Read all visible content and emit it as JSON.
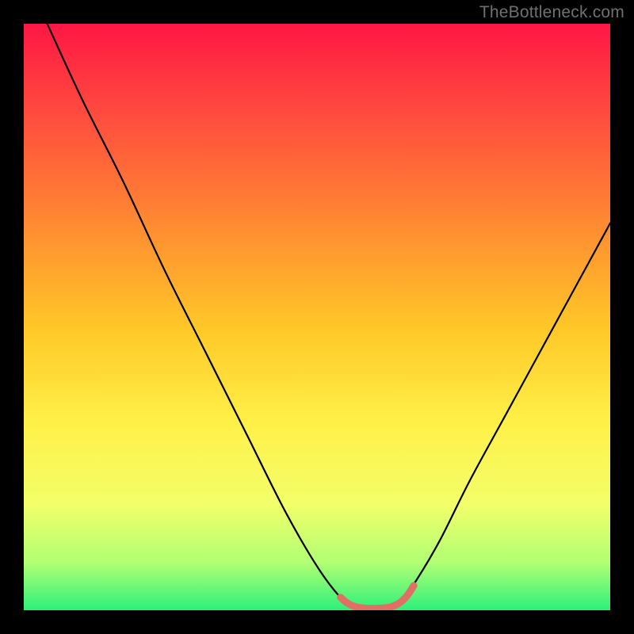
{
  "watermark": "TheBottleneck.com",
  "chart_data": {
    "type": "line",
    "title": "",
    "xlabel": "",
    "ylabel": "",
    "xlim": [
      0,
      100
    ],
    "ylim": [
      0,
      100
    ],
    "grid": false,
    "legend": false,
    "background_gradient": [
      "#ff1744",
      "#ff5a3c",
      "#ffa030",
      "#ffd82a",
      "#fff44a",
      "#f6ff70",
      "#a8ff7a",
      "#38f47a"
    ],
    "series": [
      {
        "name": "bottleneck-curve",
        "stroke": "#000000",
        "x": [
          4,
          10,
          17,
          24,
          31,
          38,
          44.5,
          50,
          54,
          56.5,
          59,
          62,
          64.5,
          67,
          71,
          76,
          82,
          88,
          94,
          100
        ],
        "values": [
          100,
          87,
          73,
          58,
          44,
          30,
          17,
          7.5,
          2.2,
          0.6,
          0.4,
          0.6,
          1.8,
          5.2,
          12,
          22,
          33,
          44,
          55,
          66
        ]
      },
      {
        "name": "flat-highlight",
        "stroke": "#e07066",
        "stroke_width": 9,
        "x": [
          54,
          55.2,
          56.5,
          58,
          59.5,
          61,
          62.5,
          64,
          65.3,
          66.5
        ],
        "values": [
          2.2,
          1.2,
          0.6,
          0.35,
          0.3,
          0.35,
          0.55,
          1.2,
          2.4,
          4.2
        ]
      }
    ]
  }
}
